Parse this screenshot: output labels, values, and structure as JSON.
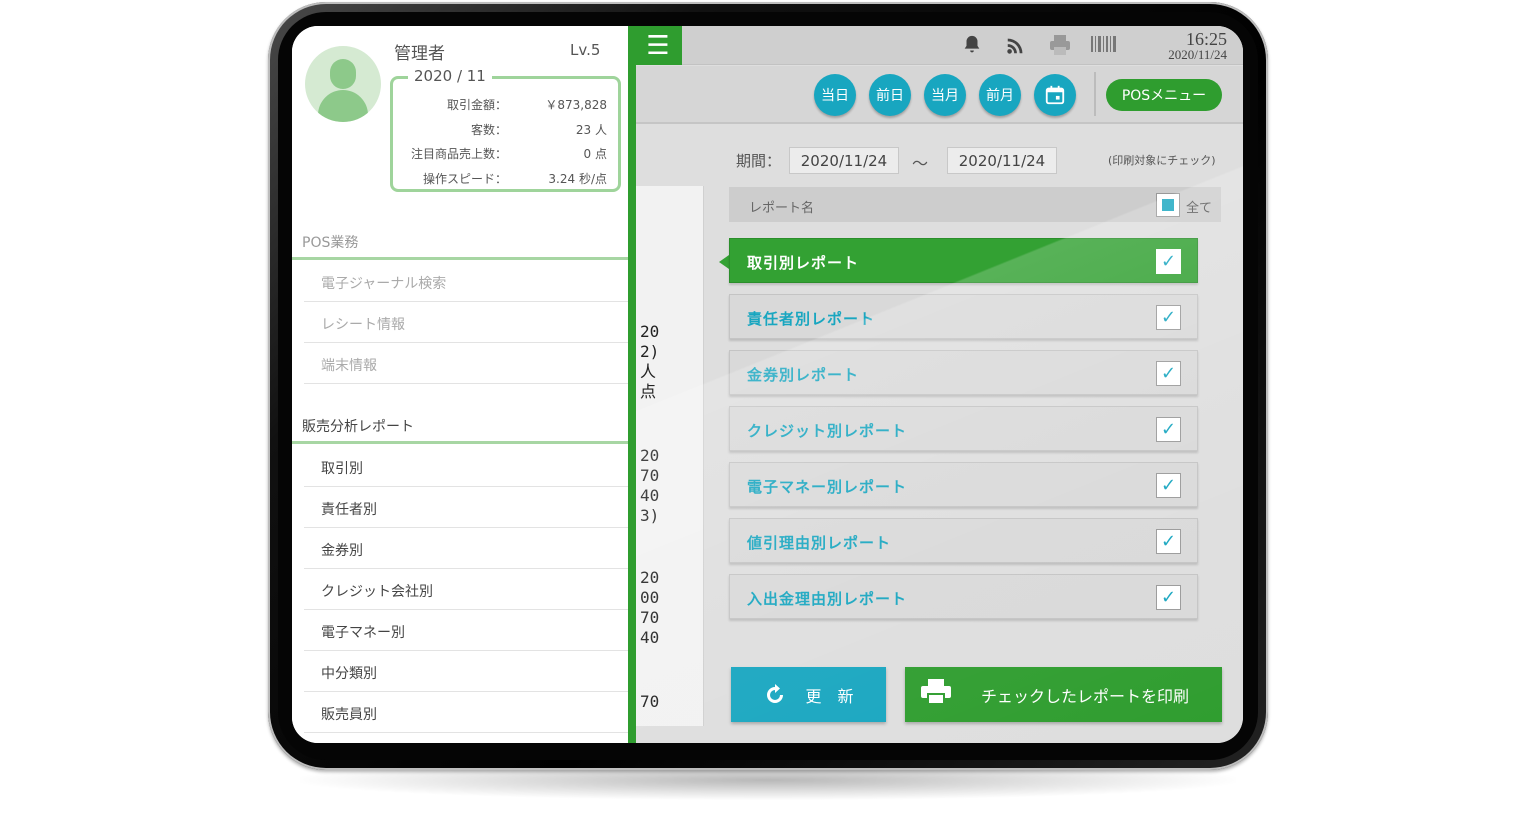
{
  "topbar": {
    "time": "16:25",
    "date": "2020/11/24"
  },
  "toolbar": {
    "buttons": [
      "当日",
      "前日",
      "当月",
      "前月"
    ],
    "pos_menu": "POSメニュー"
  },
  "period": {
    "label": "期間：",
    "from": "2020/11/24",
    "to": "2020/11/24",
    "separator": "〜",
    "hint": "(印刷対象にチェック)"
  },
  "report_list": {
    "header": "レポート名",
    "all_label": "全て",
    "items": [
      {
        "name": "取引別レポート",
        "checked": true
      },
      {
        "name": "責任者別レポート",
        "checked": true
      },
      {
        "name": "金券別レポート",
        "checked": true
      },
      {
        "name": "クレジット別レポート",
        "checked": true
      },
      {
        "name": "電子マネー別レポート",
        "checked": true
      },
      {
        "name": "値引理由別レポート",
        "checked": true
      },
      {
        "name": "入出金理由別レポート",
        "checked": true
      }
    ]
  },
  "actions": {
    "refresh": "更　新",
    "print": "チェックしたレポートを印刷"
  },
  "receipt_fragments": [
    "20",
    "2)",
    "人",
    "点",
    "20",
    "70",
    "40",
    "3)",
    "20",
    "00",
    "70",
    "40",
    "70"
  ],
  "user": {
    "name": "管理者",
    "level": "Lv.5",
    "month": "2020 / 11",
    "stats": [
      {
        "label": "取引金額：",
        "value": "￥873,828"
      },
      {
        "label": "客数：",
        "value": "23 人"
      },
      {
        "label": "注目商品売上数：",
        "value": "0 点"
      },
      {
        "label": "操作スピード：",
        "value": "3.24 秒/点"
      }
    ]
  },
  "sidebar": {
    "pos_section": "POS業務",
    "pos_items": [
      "電子ジャーナル検索",
      "レシート情報",
      "端末情報"
    ],
    "report_section": "販売分析レポート",
    "report_items": [
      "取引別",
      "責任者別",
      "金券別",
      "クレジット会社別",
      "電子マネー別",
      "中分類別",
      "販売員別"
    ]
  },
  "colors": {
    "green": "#2f9d2f",
    "cyan": "#18a6c0"
  }
}
